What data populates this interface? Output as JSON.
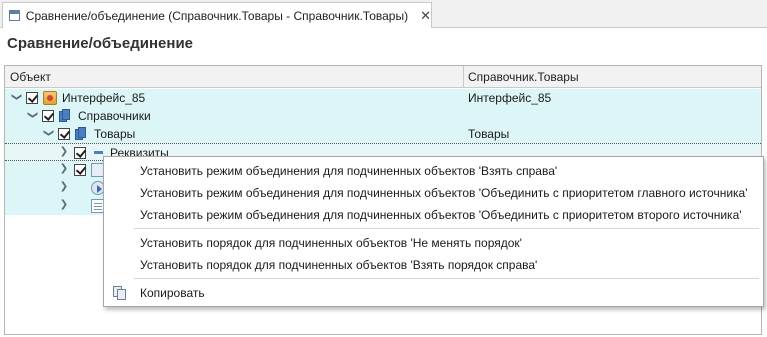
{
  "tab": {
    "title": "Сравнение/объединение (Справочник.Товары - Справочник.Товары)",
    "close_icon": "close-icon"
  },
  "form": {
    "title": "Сравнение/объединение"
  },
  "table": {
    "columns": [
      "Объект",
      "Справочник.Товары"
    ],
    "rows": [
      {
        "name": "Интерфейс_85",
        "value": "Интерфейс_85",
        "icon": "interface-icon",
        "expanded": true,
        "checked": true
      },
      {
        "name": "Справочники",
        "value": "",
        "icon": "catalogs-icon",
        "expanded": true,
        "checked": true
      },
      {
        "name": "Товары",
        "value": "Товары",
        "icon": "catalog-icon",
        "expanded": true,
        "checked": true
      },
      {
        "name": "Реквизиты",
        "value": "",
        "icon": "attributes-icon",
        "expanded": false,
        "checked": true
      },
      {
        "name": "",
        "value": "",
        "icon": "form-icon",
        "expanded": false,
        "checked": true
      },
      {
        "name": "",
        "value": "",
        "icon": "command-icon",
        "expanded": false,
        "checked": false
      },
      {
        "name": "",
        "value": "",
        "icon": "layout-icon",
        "expanded": false,
        "checked": false
      }
    ]
  },
  "context_menu": {
    "items": [
      "Установить режим объединения для подчиненных объектов 'Взять справа'",
      "Установить режим объединения для подчиненных объектов 'Объединить с приоритетом главного источника'",
      "Установить режим объединения для подчиненных объектов 'Объединить с приоритетом второго источника'",
      "Установить порядок для подчиненных объектов 'Не менять порядок'",
      "Установить порядок для подчиненных объектов 'Взять порядок справа'",
      "Копировать"
    ]
  }
}
